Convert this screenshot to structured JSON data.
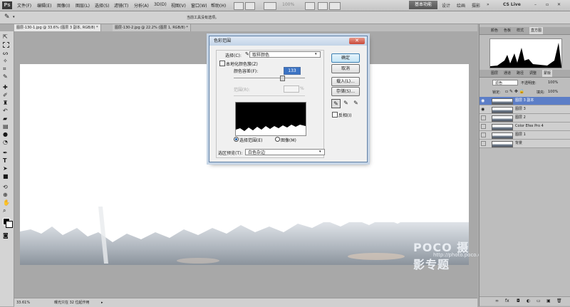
{
  "menubar": {
    "logo": "Ps",
    "items": [
      "文件(F)",
      "编辑(E)",
      "图像(I)",
      "图层(L)",
      "选择(S)",
      "滤镜(T)",
      "分析(A)",
      "3D(D)",
      "视图(V)",
      "窗口(W)",
      "帮助(H)"
    ],
    "zoom": "100%",
    "workspaces": {
      "active": "基本功能",
      "others": [
        "设计",
        "绘画",
        "摄影"
      ]
    },
    "cs_live": "CS Live"
  },
  "optbar": {
    "message": "当前工具没有选项。"
  },
  "tabs": [
    {
      "label": "图层-130-1.jpg @ 33.6% (图层 3 副本, RGB/8) *"
    },
    {
      "label": "图层-130-2.jpg @ 22.2% (图层 1, RGB/8) *"
    }
  ],
  "status": {
    "zoom": "33.61%",
    "info": "曝光只在 32 位起作用"
  },
  "watermark": {
    "brand": "POCO 摄影专题",
    "url": "http://photo.poco.cn/"
  },
  "right_panel": {
    "top_tabs": [
      "颜色",
      "色板",
      "样式",
      "直方图"
    ],
    "active_top_tab": "直方图",
    "layer_tabs": [
      "图层",
      "通道",
      "路径",
      "调整",
      "蒙版"
    ],
    "active_layer_tab": "图层",
    "blend_mode": "滤色",
    "opacity_label": "不透明度:",
    "opacity": "100%",
    "lock_label": "锁定:",
    "fill_label": "填充:",
    "fill": "100%",
    "layers": [
      {
        "name": "图层 3 副本",
        "selected": true,
        "visible": true
      },
      {
        "name": "图层 3",
        "selected": false,
        "visible": true
      },
      {
        "name": "图层 2",
        "selected": false,
        "visible": false
      },
      {
        "name": "Color Efex Pro 4",
        "selected": false,
        "visible": false
      },
      {
        "name": "图层 1",
        "selected": false,
        "visible": false
      },
      {
        "name": "背景",
        "selected": false,
        "visible": false
      }
    ]
  },
  "dialog": {
    "title": "色彩范围",
    "select_label": "选择(C):",
    "select_value": "取样颜色",
    "localized_label": "本地化颜色簇(Z)",
    "fuzziness_label": "颜色容差(F):",
    "fuzziness_value": "133",
    "range_label": "范围(R):",
    "range_unit": "%",
    "radio_selection": "选择范围(E)",
    "radio_image": "图像(M)",
    "preview_label": "选区预览(T):",
    "preview_value": "白色杂边",
    "buttons": {
      "ok": "确定",
      "cancel": "取消",
      "load": "载入(L)...",
      "save": "存储(S)..."
    },
    "invert_label": "反相(I)"
  }
}
